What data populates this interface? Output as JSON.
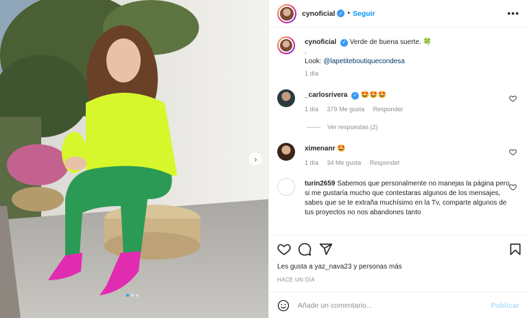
{
  "header": {
    "username": "cynoficial",
    "separator": "•",
    "follow_label": "Seguir",
    "more_label": "•••"
  },
  "photo": {
    "next_arrow": "›"
  },
  "caption": {
    "username": "cynoficial",
    "text": "Verde de buena suerte. 🍀",
    "dot": ".",
    "look_label": "Look:",
    "mention": "@lapetiteboutiquecondesa",
    "time": "1 día"
  },
  "comments": [
    {
      "username": "_carlosrivera",
      "text": "🤩🤩🤩",
      "time": "1 día",
      "likes": "379 Me gusta",
      "reply": "Responder",
      "view_replies": "Ver respuestas (2)"
    },
    {
      "username": "ximenanr",
      "text": "🤩",
      "time": "1 día",
      "likes": "34 Me gusta",
      "reply": "Responder"
    },
    {
      "username": "turin2659",
      "text": "Sabemos que personalmente no manejas la página pero si me gustaría mucho que contestaras algunos de los mensajes, sabes que se te extraña muchísimo en la Tv, comparte algunos de tus proyectos no nos abandones tanto"
    }
  ],
  "footer": {
    "likes_text": "Les gusta a yaz_nava23 y personas más",
    "time_ago": "HACE UN DÍA",
    "comment_placeholder": "Añade un comentario...",
    "publish_label": "Publicar"
  },
  "icons": {
    "like": "heart-icon",
    "comment": "comment-icon",
    "share": "share-icon",
    "save": "bookmark-icon",
    "emoji": "emoji-icon"
  },
  "colors": {
    "accent": "#0095f6",
    "verified": "#3897f0",
    "muted": "#8e8e8e",
    "publish_disabled": "#b2dffc"
  }
}
